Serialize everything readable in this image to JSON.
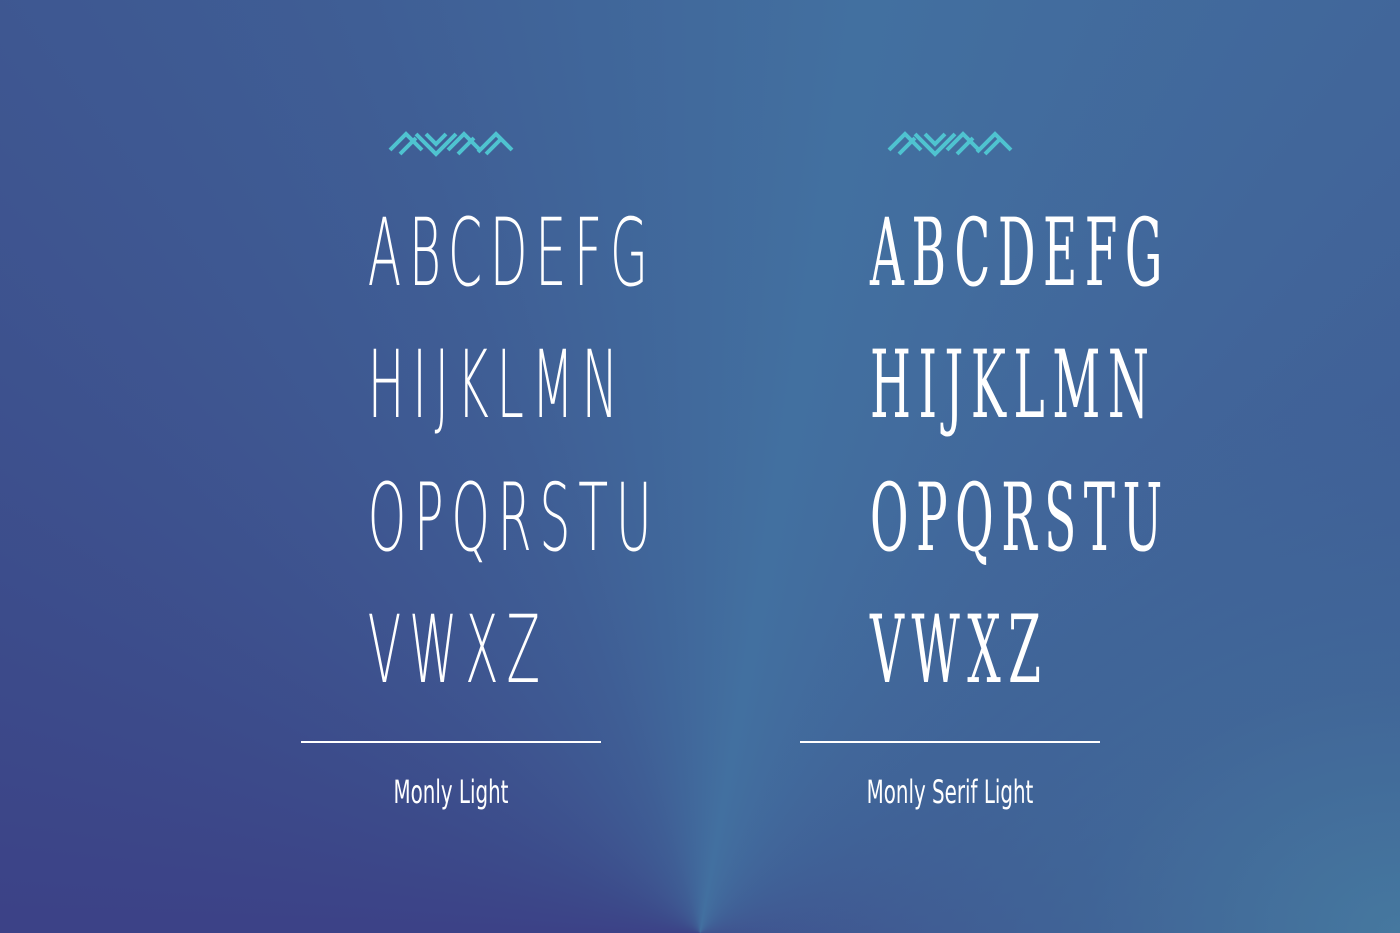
{
  "accent_color": "#4fc3d0",
  "ornament_icon": "zigzag-chevron-ornament",
  "specimens": [
    {
      "rows": [
        "ABCDEFG",
        "HIJKLMN",
        "OPQRSTU",
        "VWXZ"
      ],
      "caption": "Monly Light"
    },
    {
      "rows": [
        "ABCDEFG",
        "HIJKLMN",
        "OPQRSTU",
        "VWXZ"
      ],
      "caption": "Monly Serif Light"
    }
  ]
}
